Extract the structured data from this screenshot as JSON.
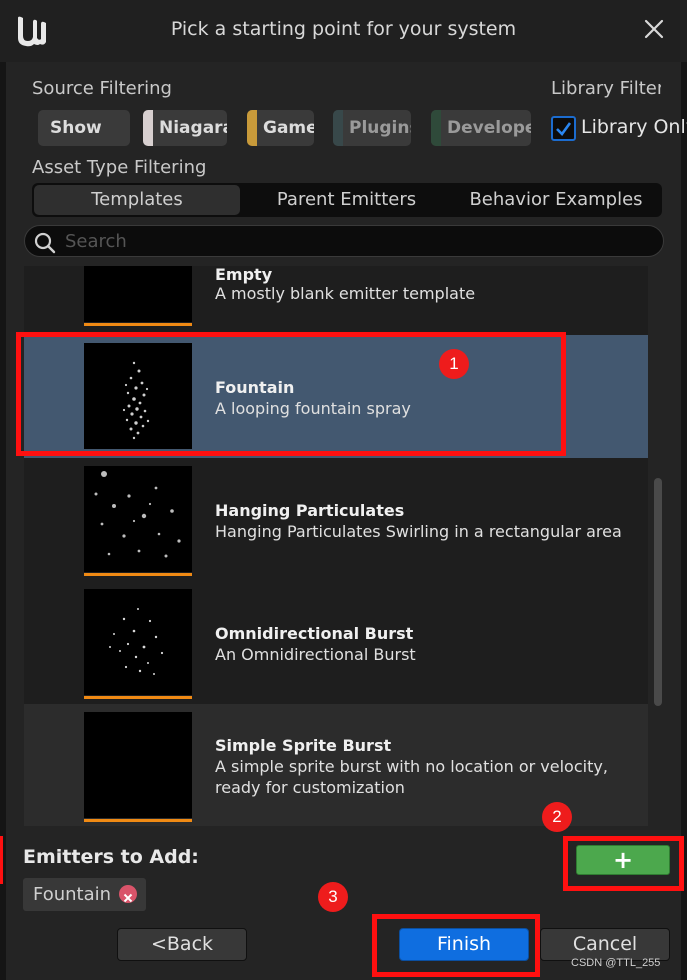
{
  "window": {
    "title": "Pick a starting point for your system",
    "logo_icon": "unreal-engine-logo",
    "close_icon": "close-icon"
  },
  "filters": {
    "source_label": "Source Filtering",
    "library_label": "Library Filter",
    "library_only_label": "Library Only",
    "library_only_checked": true,
    "chips": [
      {
        "label": "Show all",
        "color": "#3a3a3a"
      },
      {
        "label": "Niagara",
        "color": "#d8d0d0"
      },
      {
        "label": "Game",
        "color": "#c89a3a"
      },
      {
        "label": "Plugins",
        "color": "#38484a"
      },
      {
        "label": "Developer",
        "color": "#2f4a3a"
      }
    ],
    "asset_type_label": "Asset Type Filtering",
    "tabs": [
      "Templates",
      "Parent Emitters",
      "Behavior Examples"
    ],
    "active_tab": "Templates"
  },
  "search": {
    "placeholder": "Search",
    "value": ""
  },
  "emitters": [
    {
      "name": "Empty",
      "desc": "A mostly blank emitter template"
    },
    {
      "name": "Fountain",
      "desc": "A looping fountain spray",
      "selected": true
    },
    {
      "name": "Hanging Particulates",
      "desc": "Hanging Particulates Swirling in a rectangular area"
    },
    {
      "name": "Omnidirectional Burst",
      "desc": "An Omnidirectional Burst"
    },
    {
      "name": "Simple Sprite Burst",
      "desc": "A simple sprite burst with no location or velocity, ready for customization"
    }
  ],
  "to_add": {
    "label": "Emitters to Add:",
    "items": [
      "Fountain"
    ],
    "add_button": "+"
  },
  "buttons": {
    "back": "<Back",
    "finish": "Finish",
    "cancel": "Cancel"
  },
  "annotations": [
    "1",
    "2",
    "3"
  ],
  "watermark": "CSDN @TTL_255",
  "colors": {
    "selected_row": "#435870",
    "accent_orange": "#f08a14",
    "finish_blue": "#0f6ee0",
    "add_green": "#4ca84d",
    "annotation_red": "#ff1010"
  }
}
